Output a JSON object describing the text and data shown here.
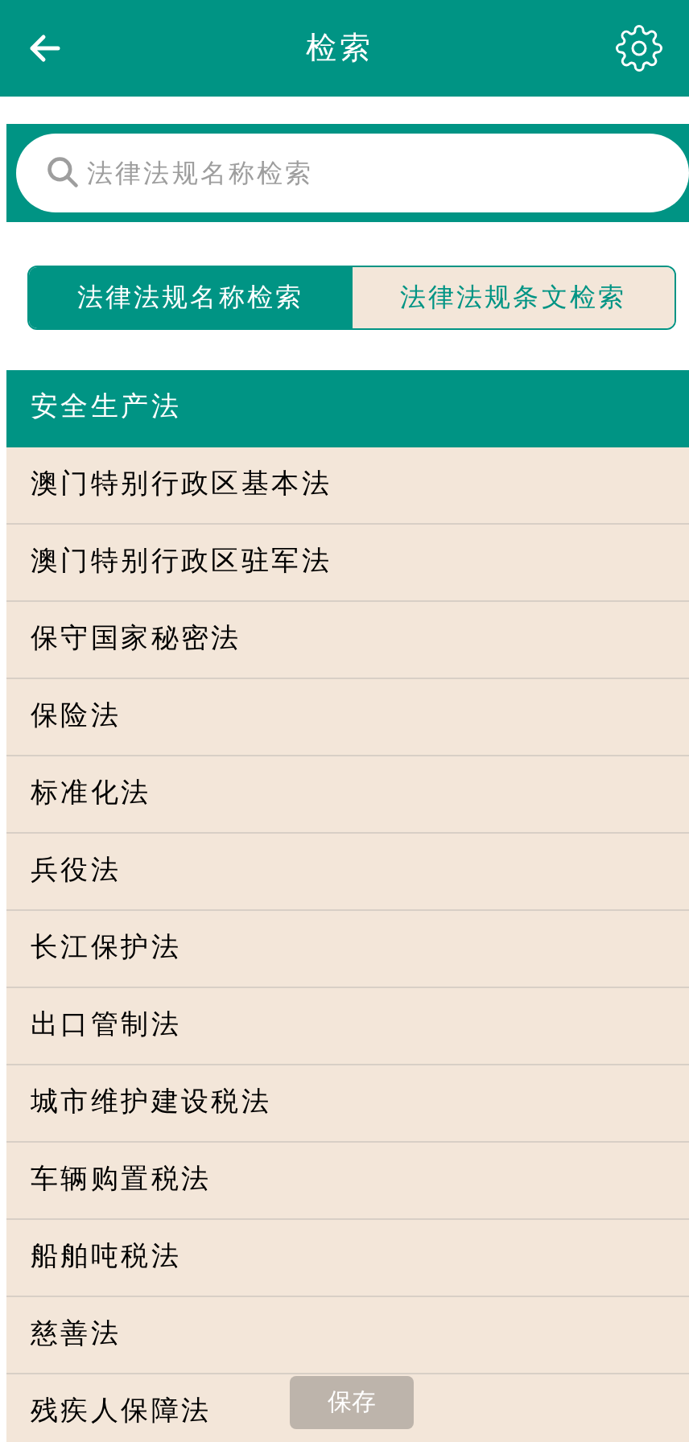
{
  "header": {
    "title": "检索"
  },
  "search": {
    "placeholder": "法律法规名称检索"
  },
  "tabs": [
    {
      "label": "法律法规名称检索",
      "selected": true
    },
    {
      "label": "法律法规条文检索",
      "selected": false
    }
  ],
  "laws": [
    {
      "name": "安全生产法",
      "selected": true
    },
    {
      "name": "澳门特别行政区基本法",
      "selected": false
    },
    {
      "name": "澳门特别行政区驻军法",
      "selected": false
    },
    {
      "name": "保守国家秘密法",
      "selected": false
    },
    {
      "name": "保险法",
      "selected": false
    },
    {
      "name": "标准化法",
      "selected": false
    },
    {
      "name": "兵役法",
      "selected": false
    },
    {
      "name": "长江保护法",
      "selected": false
    },
    {
      "name": "出口管制法",
      "selected": false
    },
    {
      "name": "城市维护建设税法",
      "selected": false
    },
    {
      "name": "车辆购置税法",
      "selected": false
    },
    {
      "name": "船舶吨税法",
      "selected": false
    },
    {
      "name": "慈善法",
      "selected": false
    },
    {
      "name": "残疾人保障法",
      "selected": false
    }
  ],
  "toast": {
    "label": "保存"
  }
}
